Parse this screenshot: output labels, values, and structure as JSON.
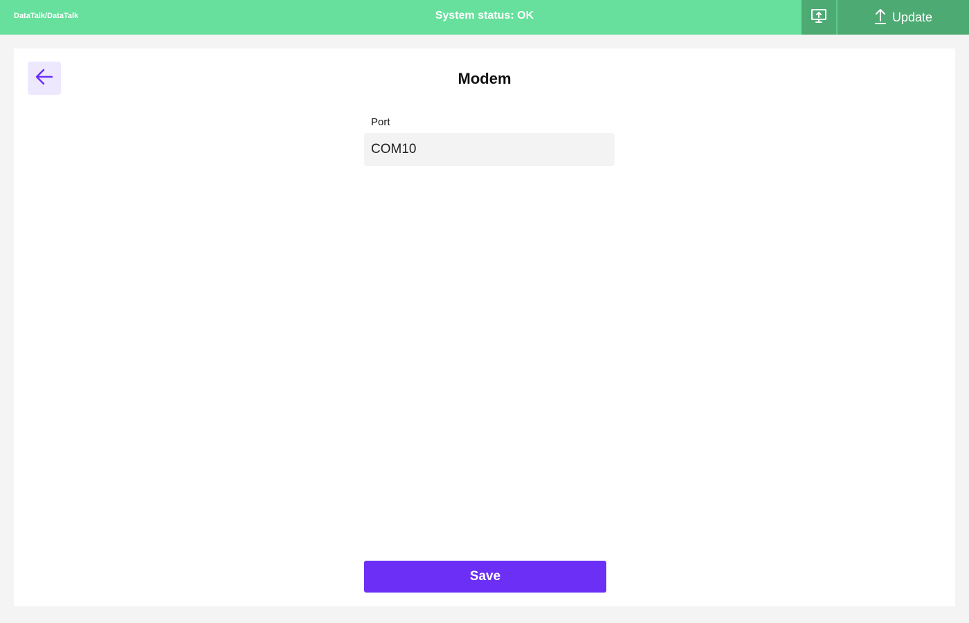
{
  "header": {
    "breadcrumb": "DataTalk/DataTalk",
    "status": "System status: OK",
    "screen_icon": "monitor-upload-icon",
    "update_icon": "upload-arrow-icon",
    "update_label": "Update",
    "colors": {
      "bar": "#66e09c",
      "button": "#4daa73"
    }
  },
  "page": {
    "title": "Modem",
    "back_icon": "arrow-left-icon",
    "accent": "#6b2ff5"
  },
  "form": {
    "port": {
      "label": "Port",
      "value": "COM10"
    },
    "save_label": "Save"
  }
}
